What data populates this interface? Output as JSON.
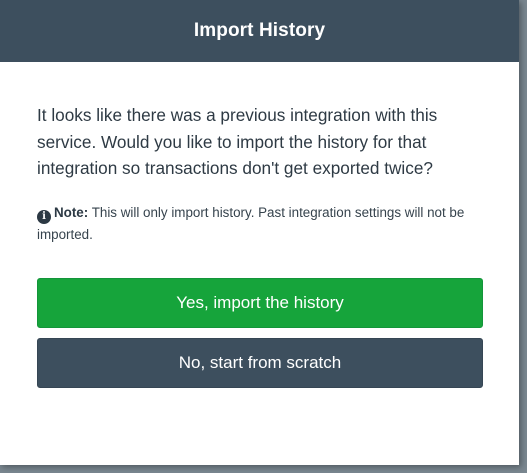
{
  "dialog": {
    "title": "Import History",
    "message": "It looks like there was a previous integration with this service. Would you like to import the history for that integration so transactions don't get exported twice?",
    "note": {
      "icon": "info-icon",
      "label": "Note:",
      "text": "This will only import history. Past integration settings will not be imported."
    },
    "buttons": {
      "confirm_label": "Yes, import the history",
      "decline_label": "No, start from scratch"
    }
  },
  "colors": {
    "header_bg": "#3d4f5e",
    "primary_button": "#16a43b",
    "secondary_button": "#3d4f5e",
    "overlay": "#7a8790"
  }
}
